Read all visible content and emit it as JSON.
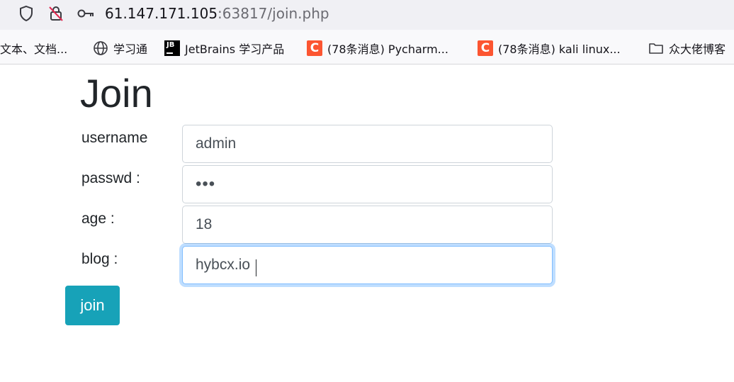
{
  "browser": {
    "url_host": "61.147.171.105",
    "url_rest": ":63817/join.php",
    "icons": [
      "shield-icon",
      "blocked-permission-icon",
      "key-icon"
    ]
  },
  "bookmarks": [
    {
      "label": "文本、文档...",
      "icon": "none"
    },
    {
      "label": "学习通",
      "icon": "globe-icon"
    },
    {
      "label": "JetBrains 学习产品",
      "icon": "jetbrains-icon",
      "icon_text": "JB"
    },
    {
      "label": "(78条消息) Pycharm...",
      "icon": "csdn-icon",
      "icon_text": "C"
    },
    {
      "label": "(78条消息) kali linux...",
      "icon": "csdn-icon",
      "icon_text": "C"
    },
    {
      "label": "众大佬博客",
      "icon": "folder-icon"
    }
  ],
  "form": {
    "title": "Join",
    "fields": [
      {
        "label": "username",
        "value": "admin",
        "type": "text"
      },
      {
        "label": "passwd :",
        "value": "abc",
        "type": "password"
      },
      {
        "label": "age :",
        "value": "18",
        "type": "text"
      },
      {
        "label": "blog :",
        "value": "hybcx.io",
        "type": "text",
        "focused": true
      }
    ],
    "submit_label": "join"
  },
  "colors": {
    "button": "#17a2b8",
    "focus_border": "#80bdff",
    "input_border": "#ced4da"
  }
}
